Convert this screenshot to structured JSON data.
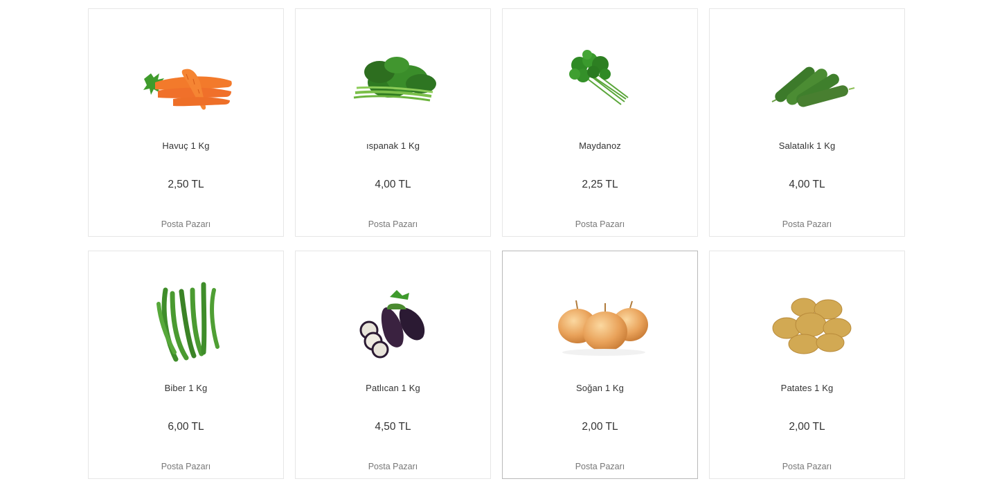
{
  "products": [
    {
      "name": "Havuç 1 Kg",
      "price": "2,50 TL",
      "seller": "Posta Pazarı",
      "image": "carrot-image"
    },
    {
      "name": "ıspanak 1 Kg",
      "price": "4,00 TL",
      "seller": "Posta Pazarı",
      "image": "spinach-image"
    },
    {
      "name": "Maydanoz",
      "price": "2,25 TL",
      "seller": "Posta Pazarı",
      "image": "parsley-image"
    },
    {
      "name": "Salatalık 1 Kg",
      "price": "4,00 TL",
      "seller": "Posta Pazarı",
      "image": "cucumber-image"
    },
    {
      "name": "Biber 1 Kg",
      "price": "6,00 TL",
      "seller": "Posta Pazarı",
      "image": "pepper-image"
    },
    {
      "name": "Patlıcan 1 Kg",
      "price": "4,50 TL",
      "seller": "Posta Pazarı",
      "image": "eggplant-image"
    },
    {
      "name": "Soğan 1 Kg",
      "price": "2,00 TL",
      "seller": "Posta Pazarı",
      "image": "onion-image"
    },
    {
      "name": "Patates 1 Kg",
      "price": "2,00 TL",
      "seller": "Posta Pazarı",
      "image": "potato-image"
    }
  ],
  "colors": {
    "card_border": "#e6e6e6",
    "card_border_hover": "#b9b9b9",
    "text_primary": "#333333",
    "text_secondary": "#777777"
  }
}
